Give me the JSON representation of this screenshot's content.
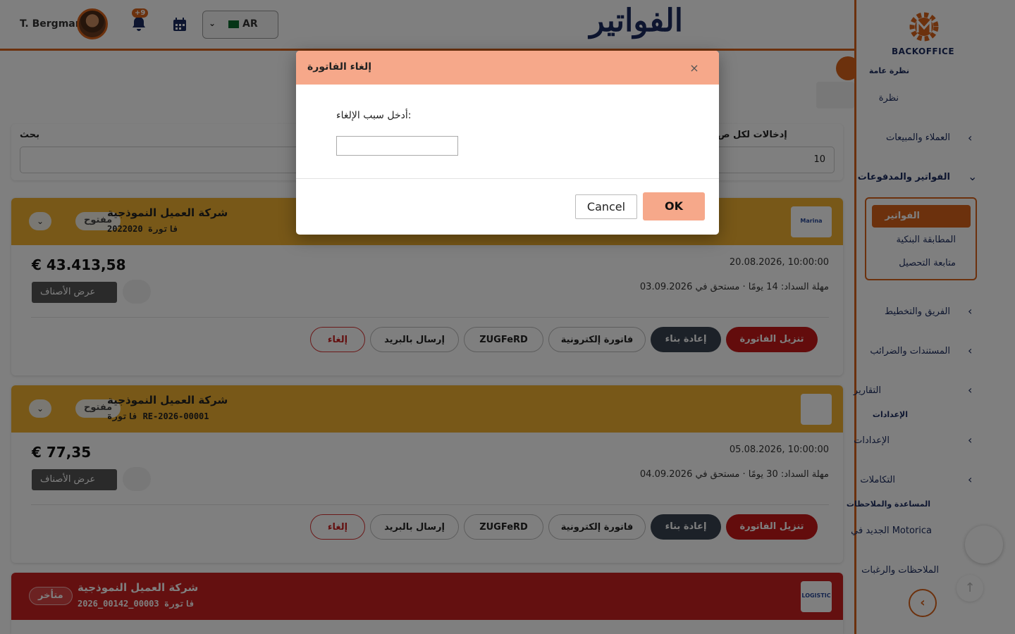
{
  "header": {
    "user_name": "T. Bergmann",
    "notification_badge": "+9",
    "language_code": "AR",
    "page_title": "الفواتير"
  },
  "sidebar": {
    "brand": "BACKOFFICE",
    "section_overview": "نظرة عامة",
    "item_overview": "نظرة",
    "item_customers": "العملاء والمبيعات",
    "item_invoices_payments": "الفواتير والمدفوعات",
    "sub_invoices": "الفواتير",
    "sub_bank_matching": "المطابقة البنكية",
    "sub_collection": "متابعة التحصيل",
    "item_team": "الفريق والتخطيط",
    "item_documents": "المستندات والضرائب",
    "item_reports": "التقارير",
    "section_settings": "الإعدادات",
    "item_settings": "الإعدادات",
    "item_integrations": "التكاملات",
    "section_help": "المساعدة والملاحظات",
    "item_whats_new": "الجديد في Motorica",
    "item_feedback": "الملاحظات والرغبات",
    "accent_color": "#d9621a"
  },
  "filters": {
    "search_label": "بحث",
    "search_value": "",
    "entries_label": "إدخالات لكل ص",
    "entries_value": "10"
  },
  "invoice_actions": {
    "view_items": "عرض الأصناف",
    "download": "تنزيل الفاتورة",
    "rebuild": "إعادة بناء",
    "einvoice": "فاتورة إلكترونية",
    "zugferd": "ZUGFeRD",
    "send_mail": "إرسال بالبريد",
    "cancel": "إلغاء"
  },
  "invoices": [
    {
      "customer": "شركة العميل النموذجية",
      "number": "فاتورة 2022020",
      "status": "مفتوح",
      "amount": "€ 43.413,58",
      "date": "20.08.2026, 10:00:00",
      "terms": "مهلة السداد: 14 يومًا · مستحق في 03.09.2026",
      "logo_text": "Marina",
      "status_color": "#f0b030"
    },
    {
      "customer": "شركة العميل النموذجية",
      "number": "فاتورة RE-2026-00001",
      "status": "مفتوح",
      "amount": "€ 77,35",
      "date": "05.08.2026, 10:00:00",
      "terms": "مهلة السداد: 30 يومًا · مستحق في 04.09.2026",
      "logo_text": "",
      "status_color": "#f0b030"
    },
    {
      "customer": "شركة العميل النموذجية",
      "number": "فاتورة 00003_00142_2026",
      "status": "متأخر",
      "logo_text": "LOGISTIC",
      "status_color": "#c82020"
    }
  ],
  "modal": {
    "title": "إلغاء الفاتورة",
    "close_symbol": "×",
    "prompt": "أدخل سبب الإلغاء:",
    "input_value": "",
    "cancel_label": "Cancel",
    "ok_label": "OK",
    "header_color": "#f6a88a"
  }
}
